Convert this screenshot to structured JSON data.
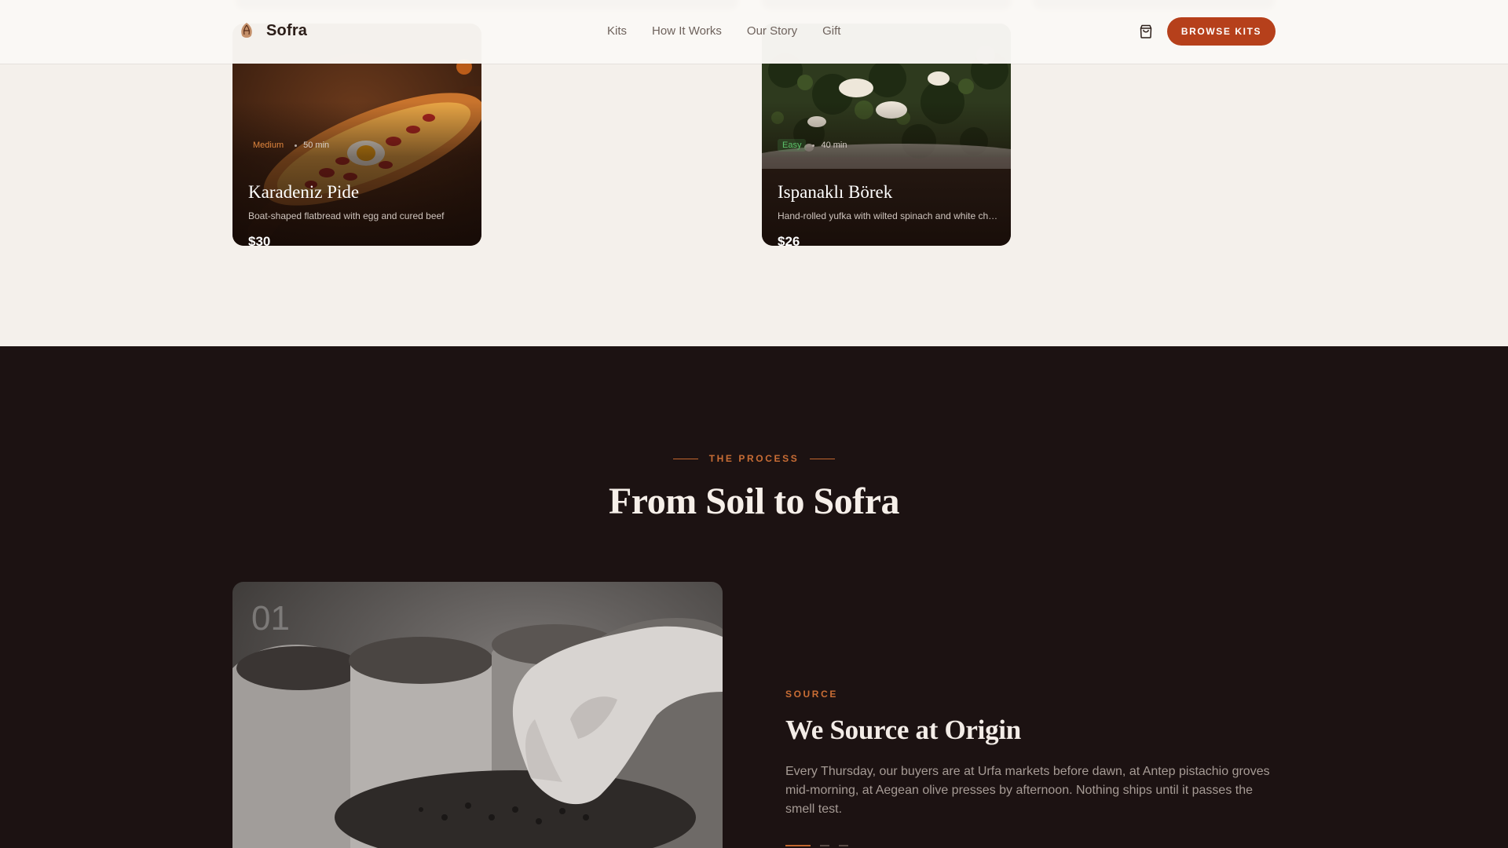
{
  "header": {
    "brand": "Sofra",
    "nav": [
      "Kits",
      "How It Works",
      "Our Story",
      "Gift"
    ],
    "cta": "BROWSE KITS"
  },
  "kits": [
    {
      "difficulty": "Medium",
      "time": "50 min",
      "title": "Karadeniz Pide",
      "description": "Boat-shaped flatbread with egg and cured beef",
      "price": "$30"
    },
    {
      "difficulty": "Easy",
      "time": "40 min",
      "title": "Ispanaklı Börek",
      "description": "Hand-rolled yufka with wilted spinach and white cheese",
      "price": "$26"
    }
  ],
  "process": {
    "eyebrow": "THE PROCESS",
    "title": "From Soil to Sofra",
    "step": {
      "number": "01",
      "label": "SOURCE",
      "title": "We Source at Origin",
      "body": "Every Thursday, our buyers are at Urfa markets before dawn, at Antep pistachio groves mid-morning, at Aegean olive presses by afternoon. Nothing ships until it passes the smell test."
    }
  },
  "colors": {
    "accent": "#b6401b",
    "dark_section": "#1c1212",
    "page_bg": "#f4f0eb"
  }
}
